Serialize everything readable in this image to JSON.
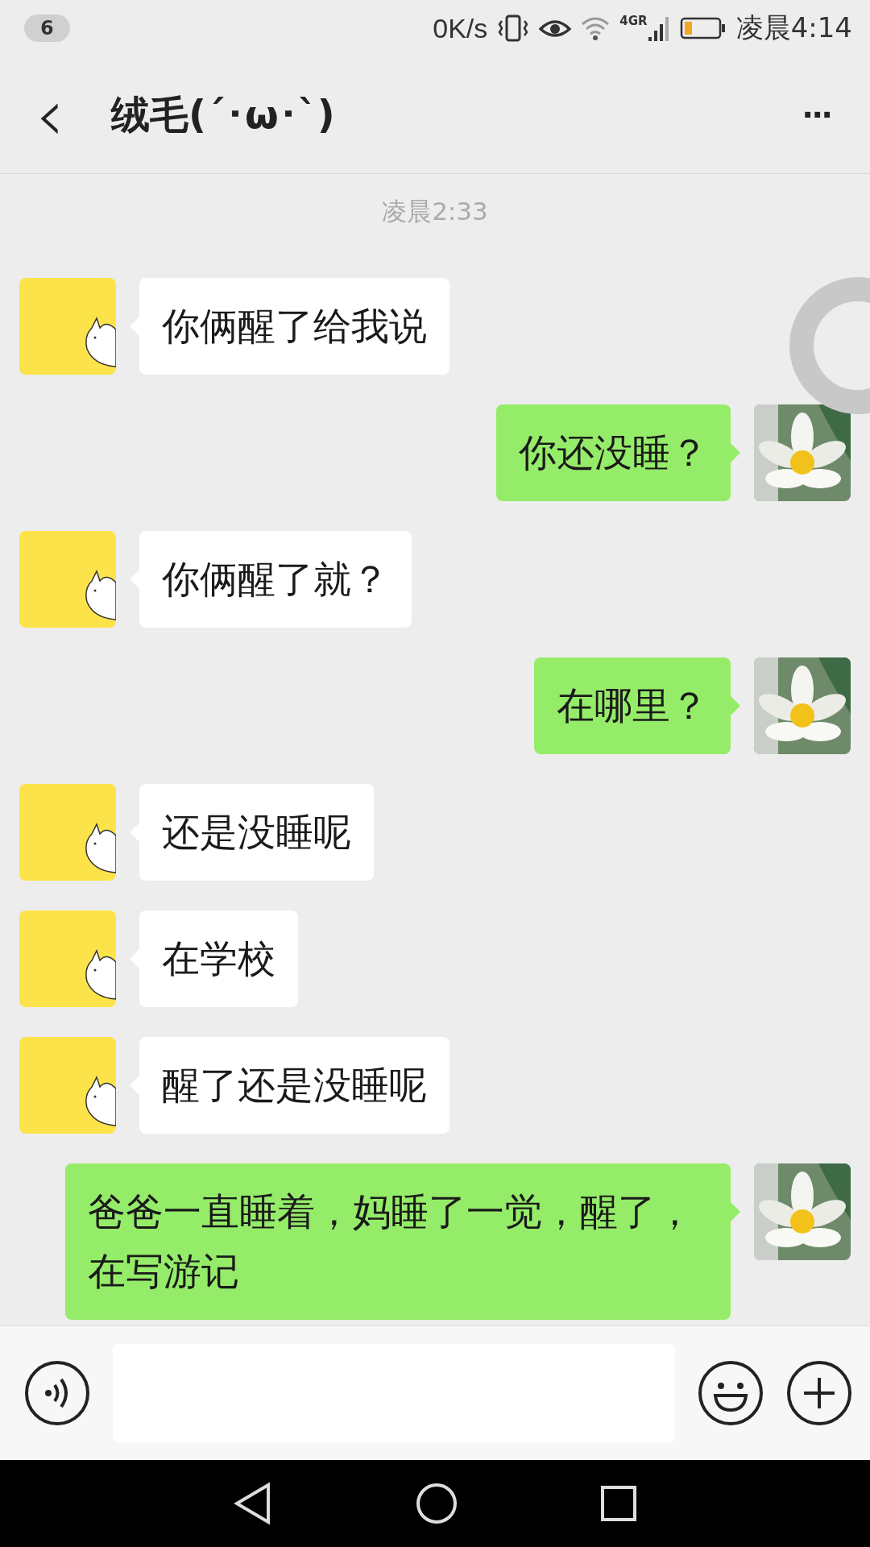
{
  "status_bar": {
    "notification_count": "6",
    "net_speed": "0K/s",
    "network": "4G",
    "roaming": "R",
    "time": "凌晨4:14"
  },
  "header": {
    "back": "‹",
    "title": "绒毛(´･ω･`)",
    "more": "···"
  },
  "timestamp": "凌晨2:33",
  "messages": [
    {
      "kind": "received",
      "text": "你俩醒了给我说"
    },
    {
      "kind": "sent",
      "text": "你还没睡？"
    },
    {
      "kind": "received",
      "text": "你俩醒了就？"
    },
    {
      "kind": "sent",
      "text": "在哪里？"
    },
    {
      "kind": "received",
      "text": "还是没睡呢"
    },
    {
      "kind": "received",
      "text": "在学校"
    },
    {
      "kind": "received",
      "text": "醒了还是没睡呢"
    },
    {
      "kind": "sent",
      "text": "爸爸一直睡着，妈睡了一觉，醒了，在写游记"
    }
  ]
}
